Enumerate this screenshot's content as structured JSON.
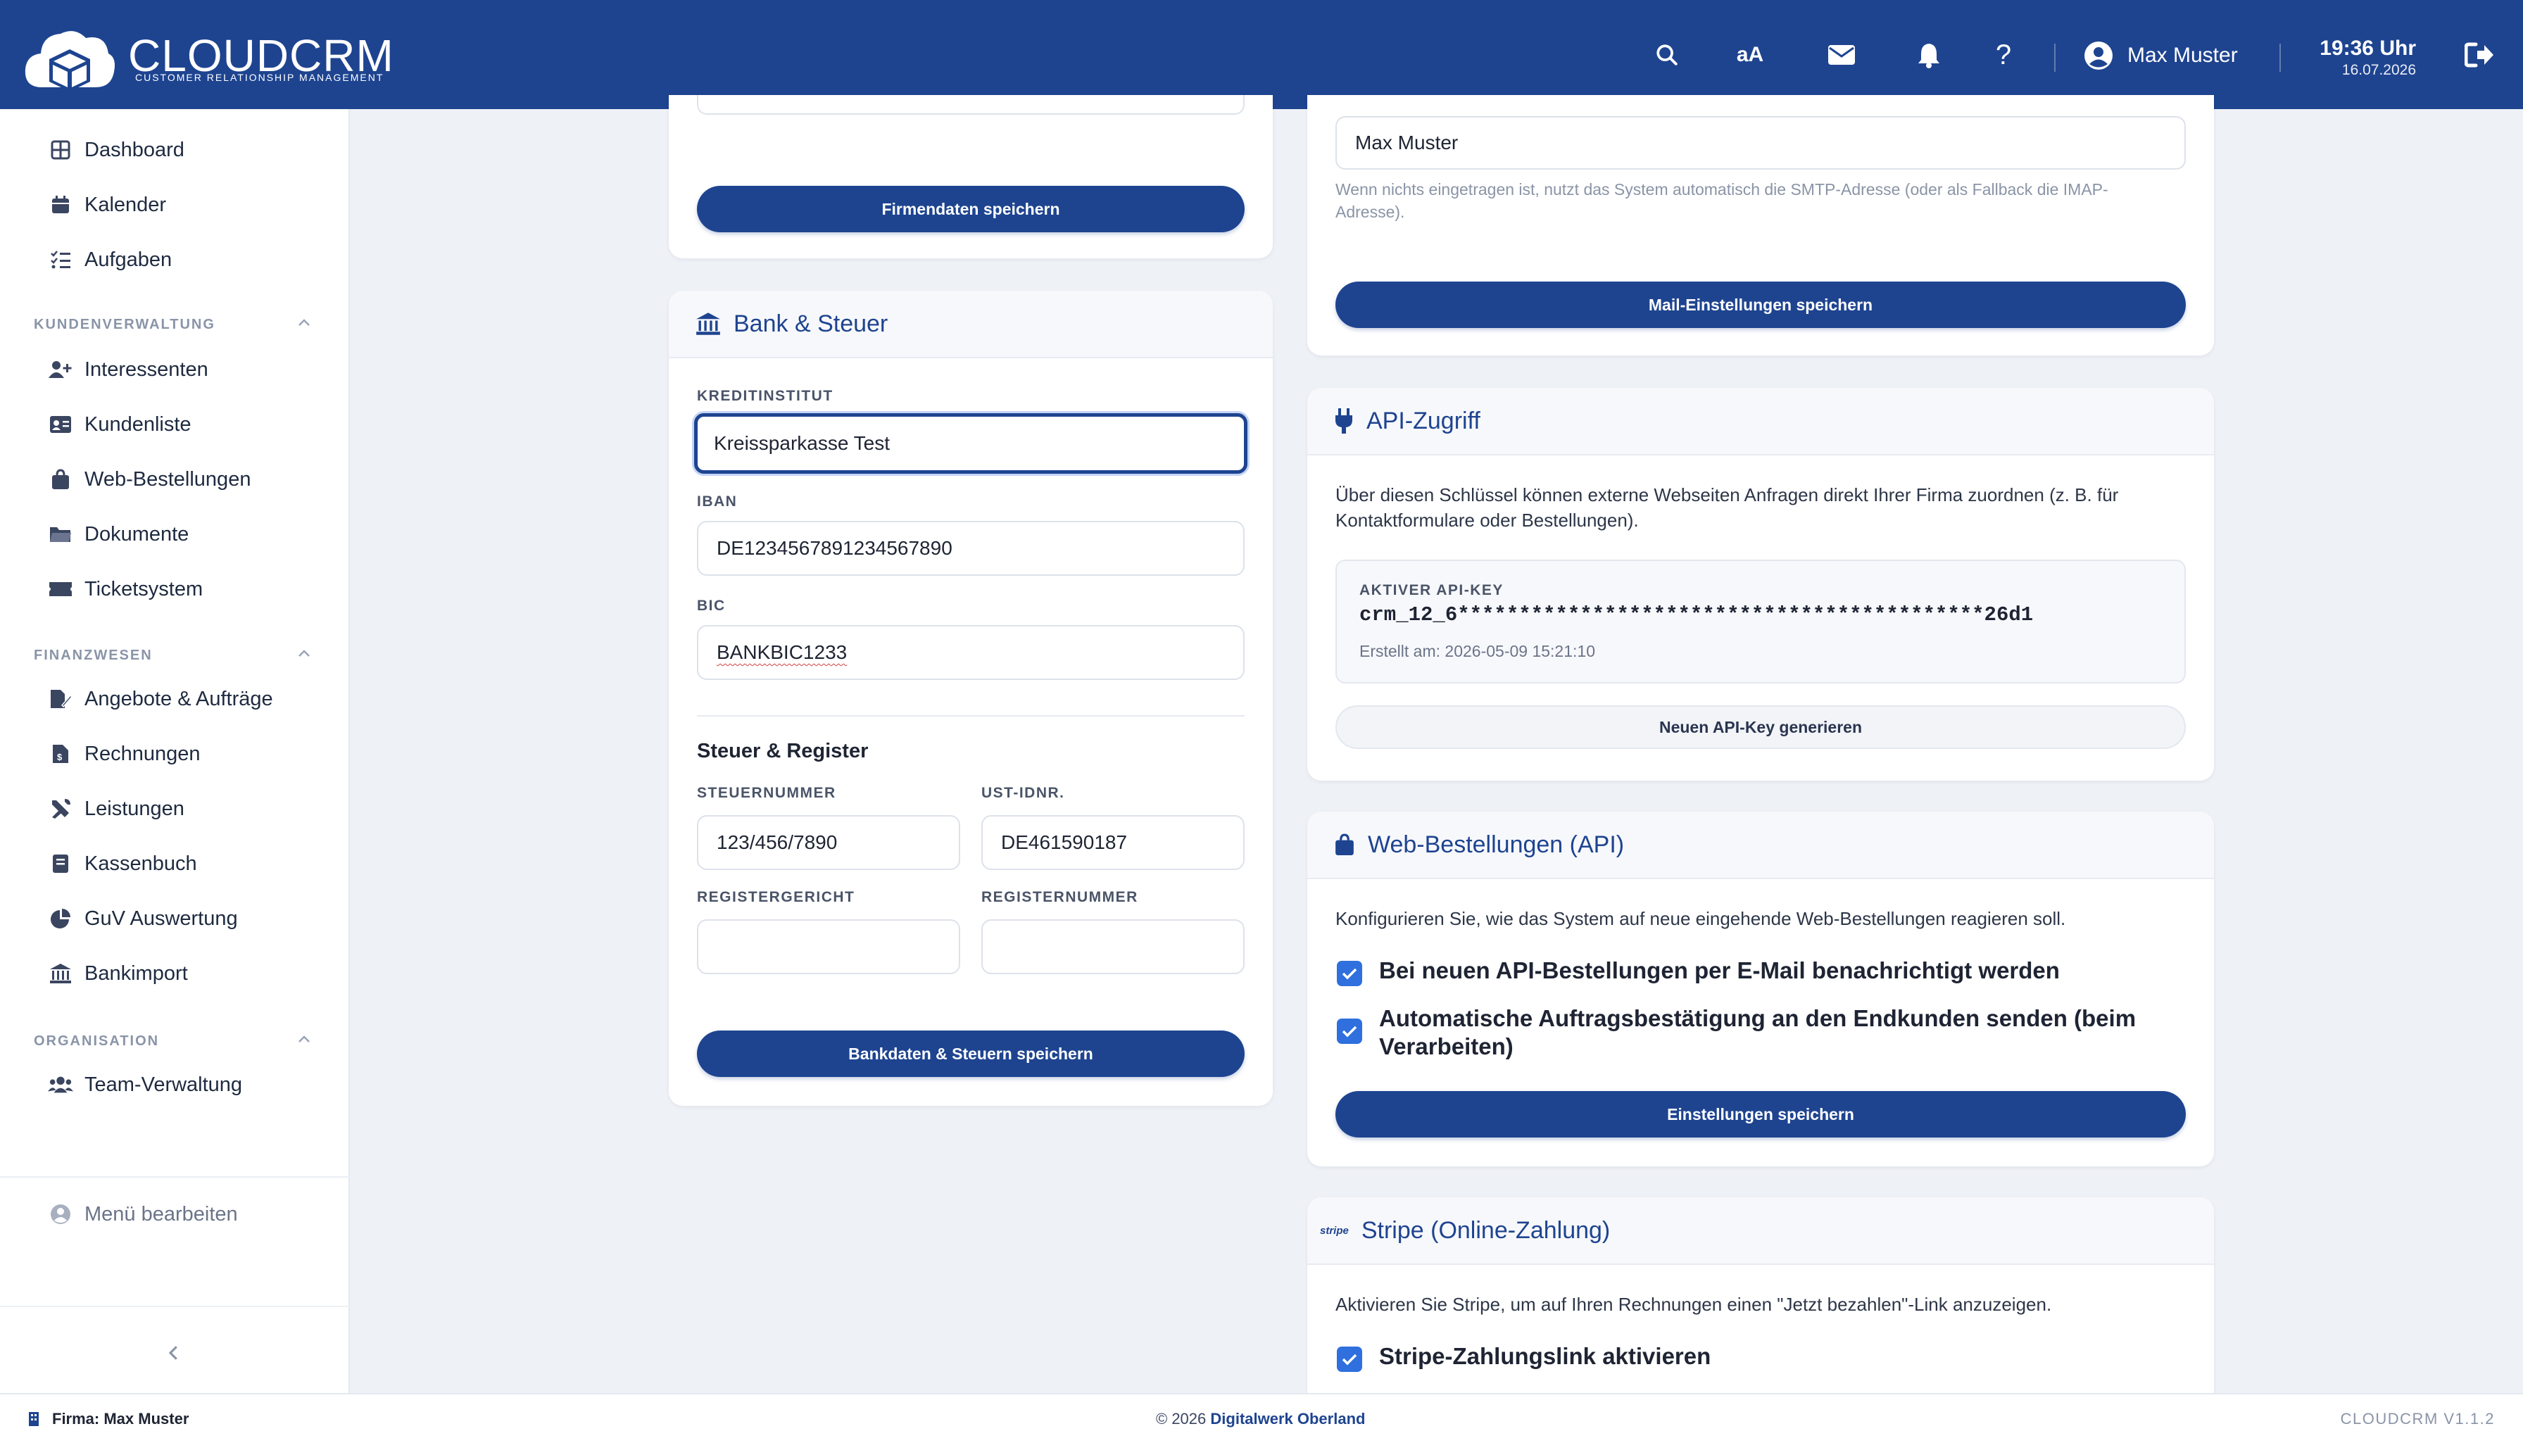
{
  "app": {
    "name": "CLOUDCRM",
    "tagline": "CUSTOMER RELATIONSHIP MANAGEMENT"
  },
  "header": {
    "font_size_label": "aA",
    "user_name": "Max Muster",
    "time": "19:36 Uhr",
    "date": "16.07.2026"
  },
  "sidebar": {
    "items_top": [
      {
        "label": "Dashboard",
        "icon": "dashboard-icon"
      },
      {
        "label": "Kalender",
        "icon": "calendar-icon"
      },
      {
        "label": "Aufgaben",
        "icon": "tasks-icon"
      }
    ],
    "sections": [
      {
        "title": "KUNDENVERWALTUNG",
        "items": [
          {
            "label": "Interessenten",
            "icon": "user-plus-icon"
          },
          {
            "label": "Kundenliste",
            "icon": "address-card-icon"
          },
          {
            "label": "Web-Bestellungen",
            "icon": "shopping-bag-icon"
          },
          {
            "label": "Dokumente",
            "icon": "folder-icon"
          },
          {
            "label": "Ticketsystem",
            "icon": "ticket-icon"
          }
        ]
      },
      {
        "title": "FINANZWESEN",
        "items": [
          {
            "label": "Angebote & Aufträge",
            "icon": "file-signature-icon"
          },
          {
            "label": "Rechnungen",
            "icon": "invoice-icon"
          },
          {
            "label": "Leistungen",
            "icon": "tools-icon"
          },
          {
            "label": "Kassenbuch",
            "icon": "book-icon"
          },
          {
            "label": "GuV Auswertung",
            "icon": "pie-chart-icon"
          },
          {
            "label": "Bankimport",
            "icon": "bank-icon"
          }
        ]
      },
      {
        "title": "ORGANISATION",
        "items": [
          {
            "label": "Team-Verwaltung",
            "icon": "users-icon"
          }
        ]
      }
    ],
    "edit_menu": "Menü bearbeiten"
  },
  "firm_card": {
    "save_button": "Firmendaten speichern"
  },
  "bank_card": {
    "title": "Bank & Steuer",
    "kreditinstitut_label": "KREDITINSTITUT",
    "kreditinstitut_value": "Kreissparkasse Test",
    "iban_label": "IBAN",
    "iban_value": "DE1234567891234567890",
    "bic_label": "BIC",
    "bic_value": "BANKBIC1233",
    "tax_heading": "Steuer & Register",
    "steuernummer_label": "STEUERNUMMER",
    "steuernummer_value": "123/456/7890",
    "ustid_label": "UST-IDNR.",
    "ustid_value": "DE461590187",
    "registergericht_label": "REGISTERGERICHT",
    "registergericht_value": "",
    "registernummer_label": "REGISTERNUMMER",
    "registernummer_value": "",
    "save_button": "Bankdaten & Steuern speichern"
  },
  "mail_card": {
    "sender_name_value": "Max Muster",
    "hint": "Wenn nichts eingetragen ist, nutzt das System automatisch die SMTP-Adresse (oder als Fallback die IMAP-Adresse).",
    "save_button": "Mail-Einstellungen speichern"
  },
  "api_card": {
    "title": "API-Zugriff",
    "description": "Über diesen Schlüssel können externe Webseiten Anfragen direkt Ihrer Firma zuordnen (z. B. für Kontaktformulare oder Bestellungen).",
    "key_label": "AKTIVER API-KEY",
    "key_value": "crm_12_6*******************************************26d1",
    "created": "Erstellt am: 2026-05-09 15:21:10",
    "generate_button": "Neuen API-Key generieren"
  },
  "web_orders_card": {
    "title": "Web-Bestellungen (API)",
    "description": "Konfigurieren Sie, wie das System auf neue eingehende Web-Bestellungen reagieren soll.",
    "option1": "Bei neuen API-Bestellungen per E-Mail benachrichtigt werden",
    "option2": "Automatische Auftragsbestätigung an den Endkunden senden (beim Verarbeiten)",
    "save_button": "Einstellungen speichern"
  },
  "stripe_card": {
    "logo_text": "stripe",
    "title": "Stripe (Online-Zahlung)",
    "description": "Aktivieren Sie Stripe, um auf Ihren Rechnungen einen \"Jetzt bezahlen\"-Link anzuzeigen.",
    "option1": "Stripe-Zahlungslink aktivieren"
  },
  "footer": {
    "firm": "Firma: Max Muster",
    "copyright": "© 2026",
    "company": "Digitalwerk Oberland",
    "version": "CLOUDCRM V1.1.2"
  },
  "colors": {
    "primary": "#1e4490",
    "checkbox": "#2f6fde",
    "background": "#eef1f6"
  }
}
